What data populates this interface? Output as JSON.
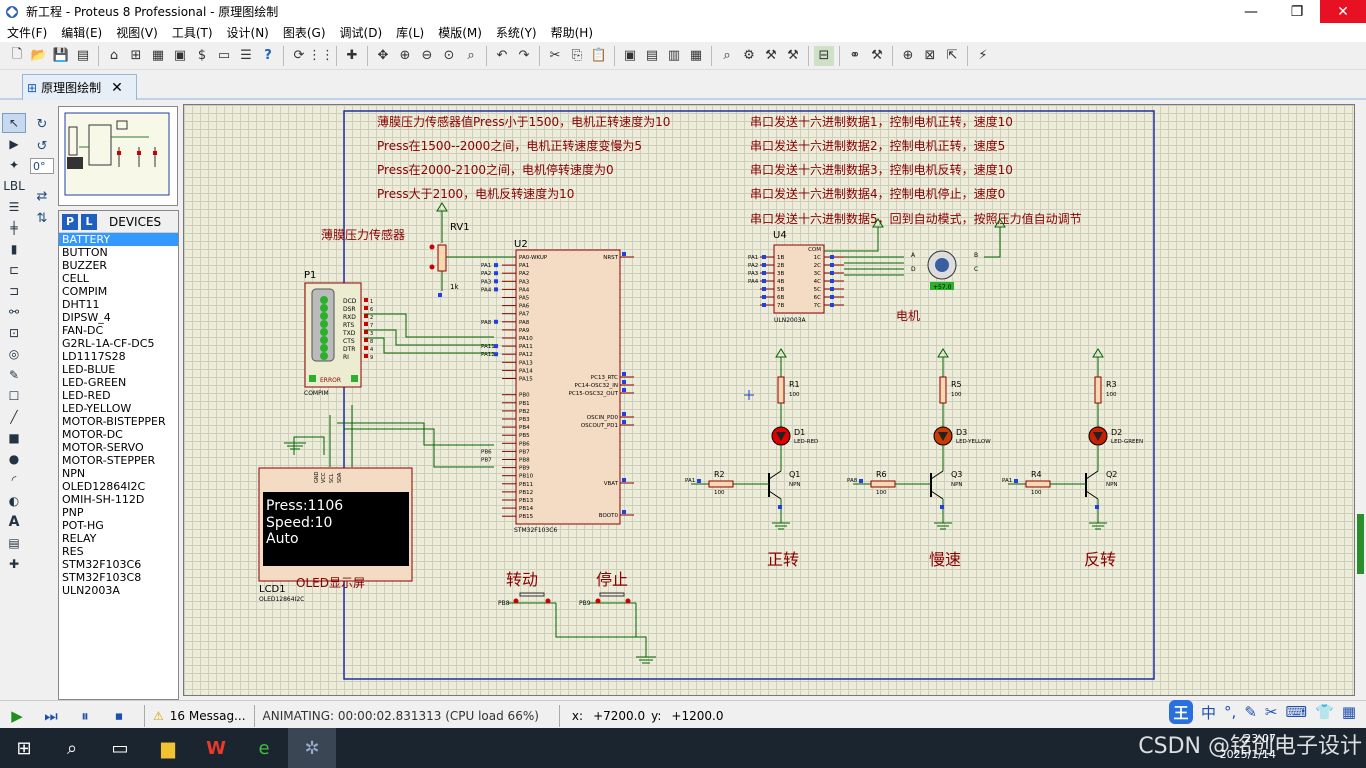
{
  "window": {
    "title": "新工程 - Proteus 8 Professional - 原理图绘制",
    "controls": [
      "—",
      "❐",
      "✕"
    ]
  },
  "menu": [
    "文件(F)",
    "编辑(E)",
    "视图(V)",
    "工具(T)",
    "设计(N)",
    "图表(G)",
    "调试(D)",
    "库(L)",
    "模版(M)",
    "系统(Y)",
    "帮助(H)"
  ],
  "tab": {
    "label": "原理图绘制",
    "close": "✕"
  },
  "rotation": {
    "angle": "0°"
  },
  "devices": {
    "header": "DEVICES",
    "pick_p": "P",
    "pick_l": "L",
    "selected": "BATTERY",
    "items": [
      "BATTERY",
      "BUTTON",
      "BUZZER",
      "CELL",
      "COMPIM",
      "DHT11",
      "DIPSW_4",
      "FAN-DC",
      "G2RL-1A-CF-DC5",
      "LD1117S28",
      "LED-BLUE",
      "LED-GREEN",
      "LED-RED",
      "LED-YELLOW",
      "MOTOR-BISTEPPER",
      "MOTOR-DC",
      "MOTOR-SERVO",
      "MOTOR-STEPPER",
      "NPN",
      "OLED12864I2C",
      "OMIH-SH-112D",
      "PNP",
      "POT-HG",
      "RELAY",
      "RES",
      "STM32F103C6",
      "STM32F103C8",
      "ULN2003A"
    ]
  },
  "schematic": {
    "notes_left": [
      "薄膜压力传感器值Press小于1500，电机正转速度为10",
      "Press在1500--2000之间，电机正转速度变慢为5",
      "Press在2000-2100之间，电机停转速度为0",
      "Press大于2100，电机反转速度为10"
    ],
    "notes_right": [
      "串口发送十六进制数据1，控制电机正转，速度10",
      "串口发送十六进制数据2，控制电机正转，速度5",
      "串口发送十六进制数据3，控制电机反转，速度10",
      "串口发送十六进制数据4，控制电机停止，速度0",
      "串口发送十六进制数据5，回到自动模式，按照压力值自动调节"
    ],
    "sensor_label": "薄膜压力传感器",
    "rv1": {
      "ref": "RV1",
      "value": "1k"
    },
    "p1": {
      "ref": "P1",
      "part": "COMPIM",
      "pins": [
        "DCD",
        "DSR",
        "RXD",
        "RTS",
        "TXD",
        "CTS",
        "DTR",
        "RI"
      ],
      "nums": [
        "1",
        "6",
        "2",
        "7",
        "3",
        "8",
        "4",
        "9"
      ],
      "error": "ERROR"
    },
    "u2": {
      "ref": "U2",
      "part": "STM32F103C6",
      "left_pins": [
        "PA0-WKUP",
        "PA1",
        "PA2",
        "PA3",
        "PA4",
        "PA5",
        "PA6",
        "PA7",
        "PA8",
        "PA9",
        "PA10",
        "PA11",
        "PA12",
        "PA13",
        "PA14",
        "PA15",
        "",
        "PB0",
        "PB1",
        "PB2",
        "PB3",
        "PB4",
        "PB5",
        "PB6",
        "PB7",
        "PB8",
        "PB9",
        "PB10",
        "PB11",
        "PB12",
        "PB13",
        "PB14",
        "PB15"
      ],
      "right_pins": [
        "NRST",
        "PC13_RTC",
        "PC14-OSC32_IN",
        "PC15-OSC32_OUT",
        "OSCIN_PD0",
        "OSCOUT_PD1",
        "VBAT",
        "BOOT0"
      ],
      "left_nets": [
        "",
        "PA1",
        "PA2",
        "PA3",
        "PA4",
        "",
        "",
        "",
        "PA8",
        "",
        "",
        "PA11",
        "PA12"
      ],
      "net_b": [
        "PB6",
        "PB7"
      ]
    },
    "u4": {
      "ref": "U4",
      "part": "ULN2003A",
      "in_pins": [
        "1B",
        "2B",
        "3B",
        "4B",
        "5B",
        "6B",
        "7B"
      ],
      "out_pins": [
        "1C",
        "2C",
        "3C",
        "4C",
        "5C",
        "6C",
        "7C"
      ],
      "com": "COM",
      "nets": [
        "PA1",
        "PA2",
        "PA3",
        "PA4"
      ]
    },
    "motor": {
      "label": "电机",
      "pins": [
        "A",
        "B",
        "C",
        "D"
      ],
      "reading": "+57.0"
    },
    "lcd": {
      "ref": "LCD1",
      "part": "OLED12864I2C",
      "lines": [
        "Press:1106",
        "Speed:10",
        "Auto"
      ],
      "label": "OLED显示屏",
      "pins": [
        "GND",
        "VCC",
        "SCL",
        "SDA"
      ]
    },
    "buttons": [
      {
        "label": "转动",
        "net": "PB8"
      },
      {
        "label": "停止",
        "net": "PB9"
      }
    ],
    "drivers": [
      {
        "r_top": "R1",
        "led": "D1",
        "led_part": "LED-RED",
        "q": "Q1",
        "r_base": "R2",
        "net": "PA1",
        "caption": "正转"
      },
      {
        "r_top": "R5",
        "led": "D3",
        "led_part": "LED-YELLOW",
        "q": "Q3",
        "r_base": "R6",
        "net": "PA8",
        "caption": "慢速"
      },
      {
        "r_top": "R3",
        "led": "D2",
        "led_part": "LED-GREEN",
        "q": "Q2",
        "r_base": "R4",
        "net": "PA1",
        "caption": "反转"
      }
    ],
    "res_value": "100",
    "npn": "NPN"
  },
  "status": {
    "messages": "16 Messag...",
    "animating": "ANIMATING: 00:00:02.831313 (CPU load 66%)",
    "x_label": "x:",
    "x_value": "+7200.0",
    "y_label": "y:",
    "y_value": "+1200.0"
  },
  "ime": [
    "王",
    "中",
    "°,",
    "✎",
    "✂",
    "⌨",
    "👕",
    "▦"
  ],
  "clock": {
    "time": "23:07",
    "date": "2025/1/14"
  },
  "watermark": "CSDN @铭创电子设计",
  "colors": {
    "canvas": "#ececd9",
    "wire": "#006400",
    "part": "#8b0000",
    "note": "#8b0000",
    "close": "#e81123"
  }
}
